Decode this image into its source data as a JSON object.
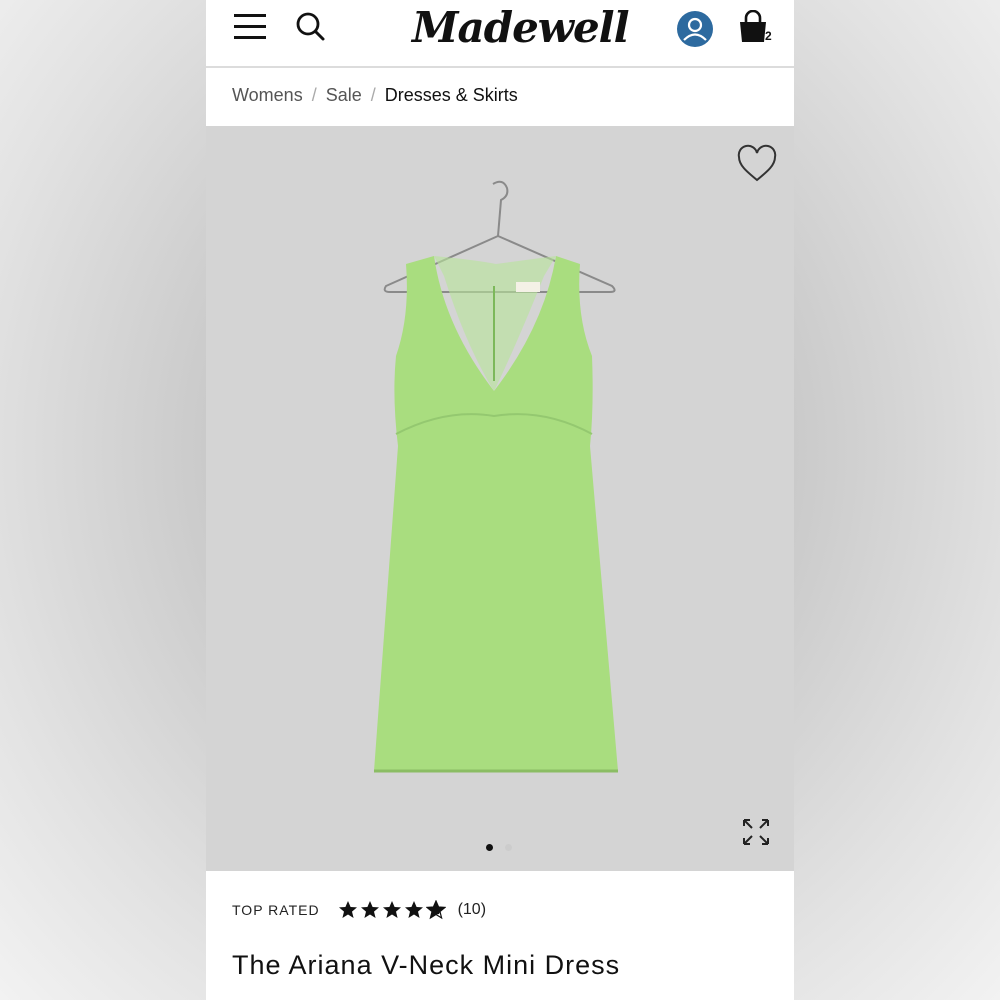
{
  "header": {
    "logo_text": "Madewell",
    "menu_icon": "hamburger-menu-icon",
    "search_icon": "search-icon",
    "account_icon": "user-account-icon",
    "bag_icon": "shopping-bag-icon",
    "bag_count": "2",
    "account_color": "#2d6a9f"
  },
  "breadcrumb": {
    "items": [
      "Womens",
      "Sale",
      "Dresses & Skirts"
    ],
    "separator": "/"
  },
  "hero": {
    "background_color": "#d4d4d4",
    "dress_color": "#a9dd7f",
    "favorite_icon": "heart-outline-icon",
    "expand_icon": "expand-arrows-icon",
    "carousel_count": 2,
    "carousel_active": 1
  },
  "product": {
    "badge": "TOP RATED",
    "rating": 4.5,
    "rating_max": 5,
    "review_count": "(10)",
    "title": "The Ariana V-Neck Mini Dress"
  }
}
